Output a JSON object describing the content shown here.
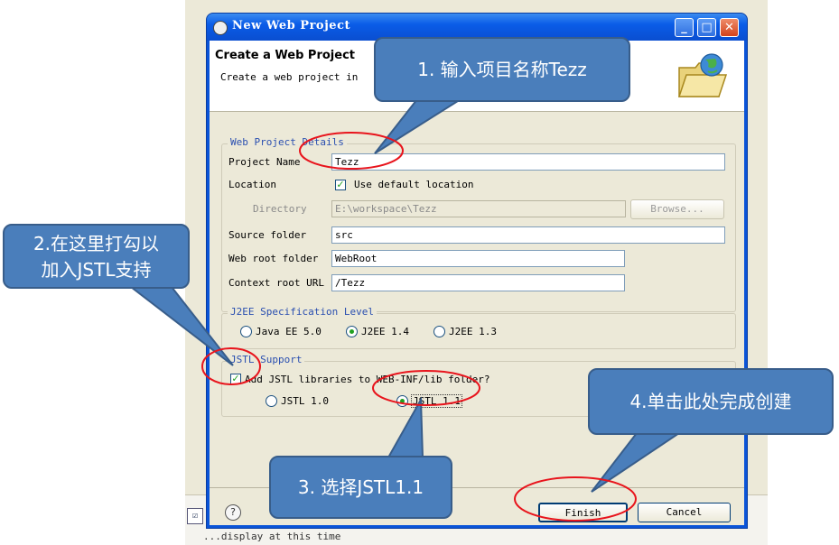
{
  "window": {
    "title": "New Web Project",
    "header_title": "Create a Web Project",
    "header_subtitle": "Create a web project in",
    "minimize_glyph": "_",
    "maximize_glyph": "□",
    "close_glyph": "✕"
  },
  "details": {
    "group_label": "Web Project Details",
    "project_name_label": "Project Name",
    "project_name_value": "Tezz",
    "location_label": "Location",
    "use_default_label": "Use default location",
    "use_default_checked": true,
    "directory_label": "Directory",
    "directory_value": "E:\\workspace\\Tezz",
    "browse_label": "Browse...",
    "source_folder_label": "Source folder",
    "source_folder_value": "src",
    "web_root_label": "Web root folder",
    "web_root_value": "WebRoot",
    "context_root_label": "Context root URL",
    "context_root_value": "/Tezz"
  },
  "j2ee": {
    "group_label": "J2EE Specification Level",
    "options": [
      "Java EE 5.0",
      "J2EE 1.4",
      "J2EE 1.3"
    ],
    "selected": "J2EE 1.4"
  },
  "jstl": {
    "group_label": "JSTL Support",
    "add_label": "Add JSTL libraries to WEB-INF/lib folder?",
    "add_checked": true,
    "options": [
      "JSTL 1.0",
      "JSTL 1.1"
    ],
    "selected": "JSTL 1.1"
  },
  "footer": {
    "help_glyph": "?",
    "finish_label": "Finish",
    "cancel_label": "Cancel"
  },
  "callouts": {
    "step1": "1. 输入项目名称Tezz",
    "step2_line1": "2.在这里打勾以",
    "step2_line2": "加入JSTL支持",
    "step3": "3. 选择JSTL1.1",
    "step4": "4.单击此处完成创建"
  },
  "background": {
    "bottom_text": "...display at this time"
  },
  "colors": {
    "callout_fill": "#4a7ebb",
    "highlight_ellipse": "#e8141c",
    "titlebar": "#0a5ce8",
    "dialog_bg": "#ece9d8"
  }
}
